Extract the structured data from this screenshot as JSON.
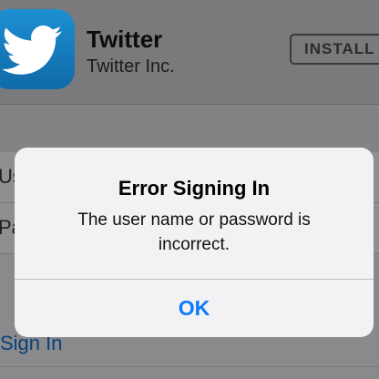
{
  "app": {
    "name": "Twitter",
    "company": "Twitter Inc.",
    "install_label": "INSTALL",
    "icon": "twitter-bird-icon"
  },
  "form": {
    "username_label": "Us",
    "password_label": "Pa",
    "sign_in_label": "Sign In"
  },
  "alert": {
    "title": "Error Signing In",
    "message": "The user name or password is incorrect.",
    "ok_label": "OK",
    "ok_color": "#0a7aff"
  }
}
